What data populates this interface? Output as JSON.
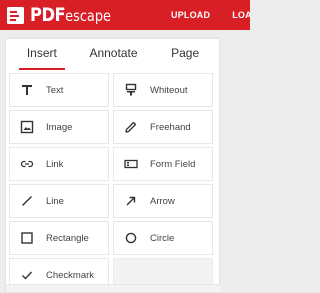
{
  "header": {
    "logo_text_main": "PDF",
    "logo_text_rest": "escape",
    "nav": [
      "UPLOAD",
      "LOAD"
    ],
    "brand_color": "#d81f26"
  },
  "tabs": [
    {
      "label": "Insert",
      "active": true
    },
    {
      "label": "Annotate",
      "active": false
    },
    {
      "label": "Page",
      "active": false
    }
  ],
  "tools": [
    {
      "label": "Text",
      "icon": "text-icon"
    },
    {
      "label": "Whiteout",
      "icon": "whiteout-icon"
    },
    {
      "label": "Image",
      "icon": "image-icon"
    },
    {
      "label": "Freehand",
      "icon": "freehand-icon"
    },
    {
      "label": "Link",
      "icon": "link-icon"
    },
    {
      "label": "Form Field",
      "icon": "form-field-icon"
    },
    {
      "label": "Line",
      "icon": "line-icon"
    },
    {
      "label": "Arrow",
      "icon": "arrow-icon"
    },
    {
      "label": "Rectangle",
      "icon": "rectangle-icon"
    },
    {
      "label": "Circle",
      "icon": "circle-icon"
    },
    {
      "label": "Checkmark",
      "icon": "checkmark-icon"
    }
  ]
}
